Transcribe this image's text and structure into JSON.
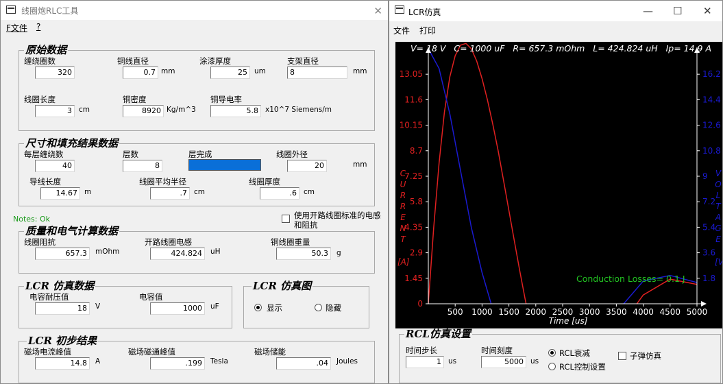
{
  "left_window": {
    "title": "线圈炮RLC工具",
    "close_glyph": "✕",
    "menu": [
      "F文件",
      "?"
    ],
    "raw": {
      "title": "原始数据",
      "turns_label": "缠绕圈数",
      "turns": "320",
      "wire_dia_label": "铜线直径",
      "wire_dia": "0.7",
      "wire_dia_unit": "mm",
      "coat_label": "涂漆厚度",
      "coat": "25",
      "coat_unit": "um",
      "frame_label": "支架直径",
      "frame": "8",
      "frame_unit": "mm",
      "length_label": "线圈长度",
      "length": "3",
      "length_unit": "cm",
      "density_label": "铜密度",
      "density": "8920",
      "density_unit": "Kg/m^3",
      "cond_label": "铜导电率",
      "cond": "5.8",
      "cond_unit": "x10^7 Siemens/m"
    },
    "size": {
      "title": "尺寸和填充结果数据",
      "per_layer_label": "每层缠绕数",
      "per_layer": "40",
      "layers_label": "层数",
      "layers": "8",
      "done_label": "层完成",
      "outer_label": "线圈外径",
      "outer": "20",
      "outer_unit": "mm",
      "wire_len_label": "导线长度",
      "wire_len": "14.67",
      "wire_len_unit": "m",
      "avg_radius_label": "线圈平均半径",
      "avg_radius": ".7",
      "avg_radius_unit": "cm",
      "thick_label": "线圈厚度",
      "thick": ".6",
      "thick_unit": "cm"
    },
    "notes": "Notes: Ok",
    "std_checkbox_label": "使用开路线圈标准的电感和阻抗",
    "mass": {
      "title": "质量和电气计算数据",
      "res_label": "线圈阻抗",
      "res": "657.3",
      "res_unit": "mOhm",
      "ind_label": "开路线圈电感",
      "ind": "424.824",
      "ind_unit": "uH",
      "weight_label": "铜线圈重量",
      "weight": "50.3",
      "weight_unit": "g"
    },
    "lcr": {
      "title": "LCR 仿真数据",
      "volt_label": "电容耐压值",
      "volt": "18",
      "volt_unit": "V",
      "cap_label": "电容值",
      "cap": "1000",
      "cap_unit": "uF"
    },
    "lcr_plot": {
      "title": "LCR 仿真图",
      "show": "显示",
      "hide": "隐藏"
    },
    "init": {
      "title": "LCR 初步结果",
      "peak_i_label": "磁场电流峰值",
      "peak_i": "14.8",
      "peak_i_unit": "A",
      "flux_label": "磁场磁通峰值",
      "flux": ".199",
      "flux_unit": "Tesla",
      "energy_label": "磁场储能",
      "energy": ".04",
      "energy_unit": "Joules"
    }
  },
  "right_window": {
    "title": "LCR仿真",
    "min_glyph": "—",
    "max_glyph": "☐",
    "close_glyph": "✕",
    "menu": [
      "文件",
      "打印"
    ],
    "settings": {
      "title": "RCL仿真设置",
      "step_label": "时间步长",
      "step": "1",
      "step_unit": "us",
      "scale_label": "时间刻度",
      "scale": "5000",
      "scale_unit": "us",
      "decay": "RCL衰减",
      "ctrl": "RCL控制设置",
      "bullet": "子弹仿真"
    }
  },
  "chart_data": {
    "type": "line",
    "header": "V= 18 V   C= 1000 uF   R= 657.3 mOhm   L= 424.824 uH   Ip= 14.9 A",
    "x_ticks": [
      "500",
      "1000",
      "1500",
      "2000",
      "2500",
      "3000",
      "3500",
      "4000",
      "4500",
      "5000"
    ],
    "x_label": "Time [us]",
    "xlim": [
      0,
      5000
    ],
    "y_left_ticks": [
      "0",
      "1.45",
      "2.9",
      "4.35",
      "5.8",
      "7.25",
      "8.7",
      "10.15",
      "11.6",
      "13.05"
    ],
    "y_left_label": [
      "C",
      "U",
      "R",
      "R",
      "E",
      "N",
      "T"
    ],
    "y_left_unit": "[A]",
    "ylim_current": [
      0,
      14.5
    ],
    "y_right_ticks": [
      "1.8",
      "3.6",
      "5.4",
      "7.2",
      "9",
      "10.8",
      "12.6",
      "14.4",
      "16.2"
    ],
    "y_right_label": [
      "V",
      "O",
      "L",
      "T",
      "A",
      "G",
      "E"
    ],
    "y_right_unit": "[V",
    "ylim_voltage": [
      0,
      18
    ],
    "annotation": "Conduction Losses= 0.1 J",
    "series": [
      {
        "name": "current",
        "color": "#e02020",
        "axis": "left",
        "points": [
          [
            0,
            0
          ],
          [
            100,
            4.3
          ],
          [
            200,
            8.0
          ],
          [
            300,
            10.9
          ],
          [
            400,
            12.9
          ],
          [
            500,
            14.1
          ],
          [
            600,
            14.7
          ],
          [
            700,
            14.8
          ],
          [
            800,
            14.5
          ],
          [
            900,
            13.8
          ],
          [
            1000,
            12.8
          ],
          [
            1100,
            11.6
          ],
          [
            1200,
            10.2
          ],
          [
            1300,
            8.7
          ],
          [
            1400,
            7.0
          ],
          [
            1500,
            5.3
          ],
          [
            1600,
            3.6
          ],
          [
            1700,
            1.9
          ],
          [
            1800,
            0.3
          ],
          [
            1900,
            -1.2
          ],
          [
            2000,
            -2.6
          ],
          [
            2500,
            -4.9
          ],
          [
            3000,
            -3.9
          ],
          [
            3500,
            -1.6
          ],
          [
            4000,
            0.5
          ],
          [
            4500,
            1.4
          ],
          [
            5000,
            1.1
          ]
        ]
      },
      {
        "name": "voltage",
        "color": "#1a1ad0",
        "axis": "right",
        "points": [
          [
            0,
            18
          ],
          [
            200,
            16.6
          ],
          [
            400,
            13.4
          ],
          [
            600,
            9.4
          ],
          [
            800,
            5.4
          ],
          [
            1000,
            2.2
          ],
          [
            1200,
            -0.4
          ],
          [
            1400,
            -2.6
          ],
          [
            1500,
            -3.4
          ],
          [
            2000,
            -5.9
          ],
          [
            2500,
            -5.9
          ],
          [
            3000,
            -3.8
          ],
          [
            3500,
            -0.6
          ],
          [
            4000,
            1.6
          ],
          [
            4500,
            2.0
          ],
          [
            5000,
            1.5
          ]
        ]
      }
    ]
  }
}
